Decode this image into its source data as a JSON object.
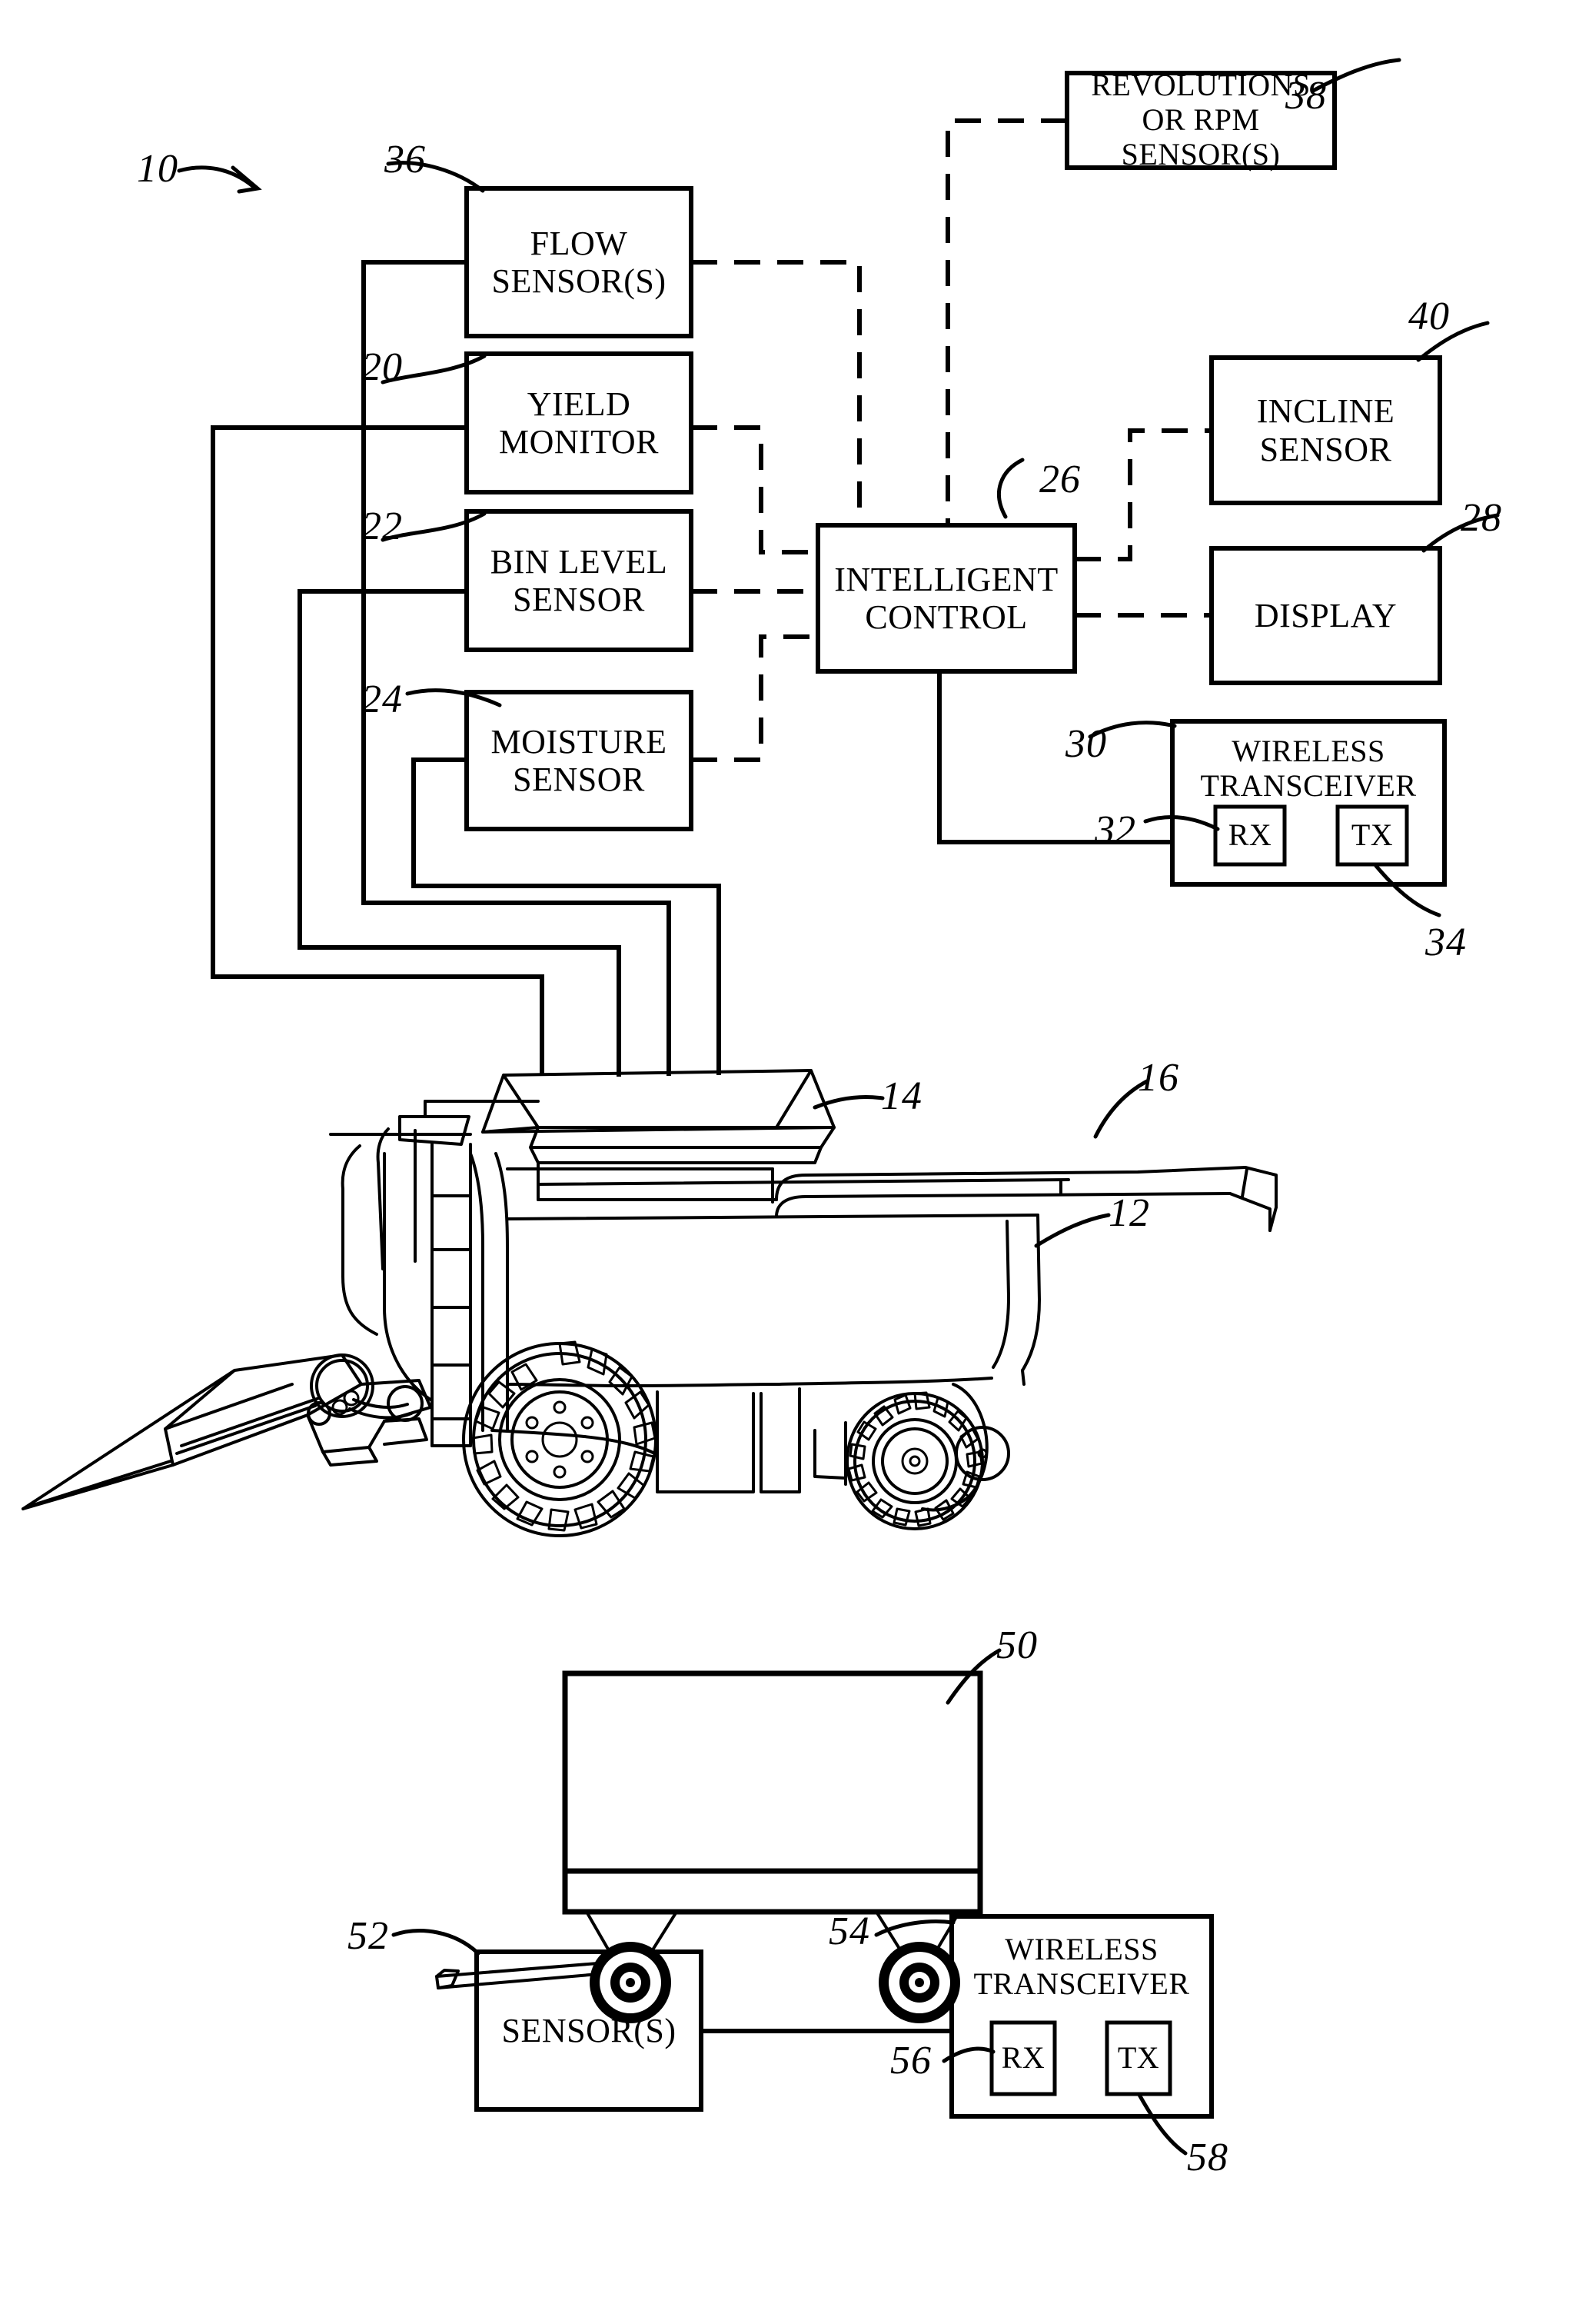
{
  "figure": {
    "type": "patent-block-diagram",
    "system_ref": "10",
    "title_none": ""
  },
  "blocks": {
    "flow_sensor": {
      "ref": "36",
      "line1": "FLOW",
      "line2": "SENSOR(S)"
    },
    "yield_monitor": {
      "ref": "20",
      "line1": "YIELD",
      "line2": "MONITOR"
    },
    "bin_level_sensor": {
      "ref": "22",
      "line1": "BIN  LEVEL",
      "line2": "SENSOR"
    },
    "moisture_sensor": {
      "ref": "24",
      "line1": "MOISTURE",
      "line2": "SENSOR"
    },
    "intelligent_control": {
      "ref": "26",
      "line1": "INTELLIGENT",
      "line2": "CONTROL"
    },
    "rpm_sensor": {
      "ref": "38",
      "line1": "REVOLUTIONS",
      "line2": "OR  RPM",
      "line3": "SENSOR(S)"
    },
    "incline_sensor": {
      "ref": "40",
      "line1": "INCLINE",
      "line2": "SENSOR"
    },
    "display": {
      "ref": "28",
      "line1": "DISPLAY"
    },
    "wireless_transceiver_combine": {
      "ref": "30",
      "line1": "WIRELESS",
      "line2": "TRANSCEIVER",
      "rx": {
        "ref": "32",
        "label": "RX"
      },
      "tx": {
        "ref": "34",
        "label": "TX"
      }
    },
    "cart_sensors": {
      "ref": "52",
      "line1": "SENSOR(S)"
    },
    "wireless_transceiver_cart": {
      "ref": "54",
      "line1": "WIRELESS",
      "line2": "TRANSCEIVER",
      "rx": {
        "ref": "56",
        "label": "RX"
      },
      "tx": {
        "ref": "58",
        "label": "TX"
      }
    }
  },
  "vehicles": {
    "combine": {
      "body_ref": "12",
      "grain_tank_ref": "14",
      "unloading_auger_ref": "16",
      "name": "combine-harvester"
    },
    "grain_cart": {
      "ref": "50",
      "name": "grain-cart"
    }
  },
  "colors": {
    "ink": "#000000",
    "paper": "#ffffff"
  }
}
